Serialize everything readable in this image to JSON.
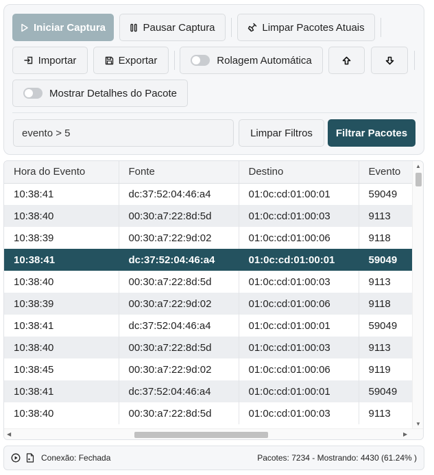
{
  "toolbar": {
    "start_label": "Iniciar Captura",
    "pause_label": "Pausar Captura",
    "clear_label": "Limpar Pacotes Atuais",
    "import_label": "Importar",
    "export_label": "Exportar",
    "autoscroll_label": "Rolagem Automática",
    "details_label": "Mostrar Detalhes do Pacote"
  },
  "filter": {
    "value": "evento > 5",
    "clear_label": "Limpar Filtros",
    "apply_label": "Filtrar Pacotes"
  },
  "table": {
    "columns": [
      "Hora do Evento",
      "Fonte",
      "Destino",
      "Evento"
    ],
    "rows": [
      [
        "10:38:41",
        "dc:37:52:04:46:a4",
        "01:0c:cd:01:00:01",
        "59049"
      ],
      [
        "10:38:40",
        "00:30:a7:22:8d:5d",
        "01:0c:cd:01:00:03",
        "9113"
      ],
      [
        "10:38:39",
        "00:30:a7:22:9d:02",
        "01:0c:cd:01:00:06",
        "9118"
      ],
      [
        "10:38:41",
        "dc:37:52:04:46:a4",
        "01:0c:cd:01:00:01",
        "59049"
      ],
      [
        "10:38:40",
        "00:30:a7:22:8d:5d",
        "01:0c:cd:01:00:03",
        "9113"
      ],
      [
        "10:38:39",
        "00:30:a7:22:9d:02",
        "01:0c:cd:01:00:06",
        "9118"
      ],
      [
        "10:38:41",
        "dc:37:52:04:46:a4",
        "01:0c:cd:01:00:01",
        "59049"
      ],
      [
        "10:38:40",
        "00:30:a7:22:8d:5d",
        "01:0c:cd:01:00:03",
        "9113"
      ],
      [
        "10:38:45",
        "00:30:a7:22:9d:02",
        "01:0c:cd:01:00:06",
        "9119"
      ],
      [
        "10:38:41",
        "dc:37:52:04:46:a4",
        "01:0c:cd:01:00:01",
        "59049"
      ],
      [
        "10:38:40",
        "00:30:a7:22:8d:5d",
        "01:0c:cd:01:00:03",
        "9113"
      ]
    ],
    "selected_row": 3
  },
  "status": {
    "connection": "Conexão: Fechada",
    "summary": "Pacotes: 7234 - Mostrando: 4430 (61.24% )"
  },
  "icons": {
    "start": "play-icon",
    "pause": "pause-icon",
    "clear": "broom-icon",
    "import": "import-icon",
    "export": "save-icon",
    "scroll_up": "arrow-up-icon",
    "scroll_down": "arrow-down-icon",
    "status_play": "play-circle-icon",
    "status_file": "file-icon"
  },
  "colors": {
    "accent": "#24525f",
    "accent_disabled": "#9fb3ba",
    "row_alt": "#eceef1"
  }
}
